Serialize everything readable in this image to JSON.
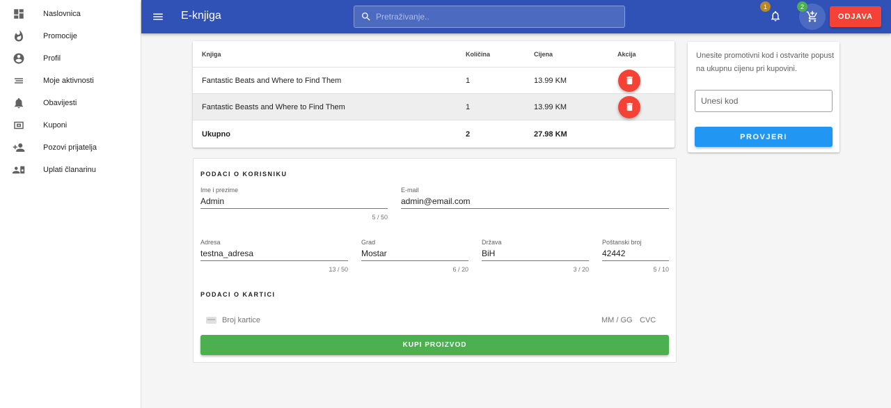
{
  "sidebar": {
    "items": [
      {
        "label": "Naslovnica",
        "icon": "dashboard-icon"
      },
      {
        "label": "Promocije",
        "icon": "fire-icon"
      },
      {
        "label": "Profil",
        "icon": "account-circle-icon"
      },
      {
        "label": "Moje aktivnosti",
        "icon": "activity-list-icon"
      },
      {
        "label": "Obavijesti",
        "icon": "bell-icon"
      },
      {
        "label": "Kuponi",
        "icon": "coupon-icon"
      },
      {
        "label": "Pozovi prijatelja",
        "icon": "add-person-icon"
      },
      {
        "label": "Uplati članarinu",
        "icon": "membership-payment-icon"
      }
    ]
  },
  "header": {
    "title": "E-knjiga",
    "search_placeholder": "Pretraživanje..",
    "notifications_count": "1",
    "cart_count": "2",
    "logout_label": "ODJAVA",
    "colors": {
      "bar": "#3052b7",
      "logout": "#f44336"
    }
  },
  "cart": {
    "columns": [
      "Knjiga",
      "Količina",
      "Cijena",
      "Akcija"
    ],
    "rows": [
      {
        "book": "Fantastic Beats and Where to Find Them",
        "qty": "1",
        "price": "13.99 KM"
      },
      {
        "book": "Fantastic Beasts and Where to Find Them",
        "qty": "1",
        "price": "13.99 KM"
      }
    ],
    "total": {
      "label": "Ukupno",
      "qty": "2",
      "price": "27.98 KM"
    }
  },
  "promo": {
    "text": "Unesite promotivni kod i ostvarite popust na ukupnu cijenu pri kupovini.",
    "input_placeholder": "Unesi kod",
    "button_label": "PROVJERI"
  },
  "user_form": {
    "section_title": "PODACI O KORISNIKU",
    "name": {
      "label": "Ime i prezime",
      "value": "Admin",
      "counter": "5 / 50"
    },
    "email": {
      "label": "E-mail",
      "value": "admin@email.com"
    },
    "address": {
      "label": "Adresa",
      "value": "testna_adresa",
      "counter": "13 / 50"
    },
    "city": {
      "label": "Grad",
      "value": "Mostar",
      "counter": "6 / 20"
    },
    "country": {
      "label": "Država",
      "value": "BiH",
      "counter": "3 / 20"
    },
    "postal": {
      "label": "Poštanski broj",
      "value": "42442",
      "counter": "5 / 10"
    }
  },
  "card_form": {
    "section_title": "PODACI O KARTICI",
    "number_placeholder": "Broj kartice",
    "expiry_placeholder": "MM / GG",
    "cvc_placeholder": "CVC"
  },
  "buy_button_label": "KUPI PROIZVOD"
}
